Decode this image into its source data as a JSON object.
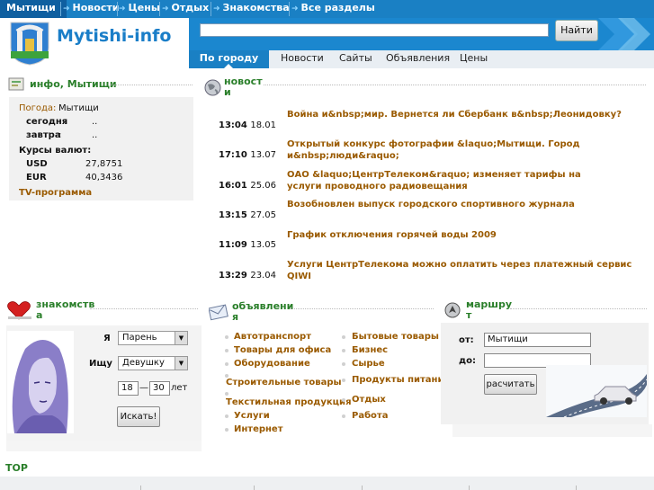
{
  "nav": {
    "items": [
      "Мытищи",
      "Новости",
      "Цены",
      "Отдых",
      "Знакомства",
      "Все разделы"
    ]
  },
  "logo": {
    "text": "Mytishi-info"
  },
  "search": {
    "button": "Найти",
    "value": ""
  },
  "subnav": {
    "active": "По городу",
    "items": [
      "Новости",
      "Сайты",
      "Объявления",
      "Цены"
    ]
  },
  "info": {
    "title": "инфо, Мытищи",
    "weather_label": "Погода:",
    "weather_city": "Мытищи",
    "today_label": "сегодня",
    "today_value": "..",
    "tomorrow_label": "завтра",
    "tomorrow_value": "..",
    "rates_label": "Курсы валют:",
    "usd_label": "USD",
    "usd_value": "27,8751",
    "eur_label": "EUR",
    "eur_value": "40,3436",
    "tv_link": "TV-программа"
  },
  "news": {
    "title_line1": "новост",
    "title_line2": "и",
    "items": [
      {
        "time": "13:04",
        "date": "18.01",
        "title": "Война и&nbsp;мир. Вернется ли Сбербанк в&nbsp;Леонидовку?"
      },
      {
        "time": "17:10",
        "date": "13.07",
        "title": "Открытый конкурс фотографии &laquo;Мытищи. Город и&nbsp;люди&raquo;"
      },
      {
        "time": "16:01",
        "date": "25.06",
        "title": "ОАО &laquo;ЦентрТелеком&raquo; изменяет тарифы на услуги проводного радиовещания"
      },
      {
        "time": "13:15",
        "date": "27.05",
        "title": "Возобновлен выпуск городского спортивного журнала"
      },
      {
        "time": "11:09",
        "date": "13.05",
        "title": "График отключения горячей воды 2009"
      },
      {
        "time": "13:29",
        "date": "23.04",
        "title": "Услуги ЦентрТелекома можно оплатить через платежный сервис QIWI"
      }
    ]
  },
  "dating": {
    "title_line1": "знакомств",
    "title_line2": "а",
    "i_label": "Я",
    "i_value": "Парень",
    "seek_label": "Ищу",
    "seek_value": "Девушку",
    "age_from": "18",
    "age_dash": "—",
    "age_to": "30",
    "age_unit": "лет",
    "search_button": "Искать!"
  },
  "ads": {
    "title_line1": "объявлени",
    "title_line2": "я",
    "left": [
      "Автотранспорт",
      "Товары для офиса",
      "Оборудование",
      "Строительные товары",
      "Текстильная продукция",
      "Услуги",
      "Интернет"
    ],
    "right": [
      "Бытовые товары",
      "Бизнес",
      "Сырье",
      "Продукты питания",
      "Отдых",
      "Работа"
    ]
  },
  "route": {
    "title_line1": "маршру",
    "title_line2": "т",
    "from_label": "от:",
    "from_value": "Мытищи",
    "to_label": "до:",
    "to_value": "",
    "button": "расчитать"
  },
  "top": {
    "label": "TOP"
  },
  "colors": {
    "nav_blue": "#1a80c4",
    "header_blue": "#1b87cf",
    "link_brown": "#9a5a00",
    "title_green": "#2a7f2a"
  }
}
